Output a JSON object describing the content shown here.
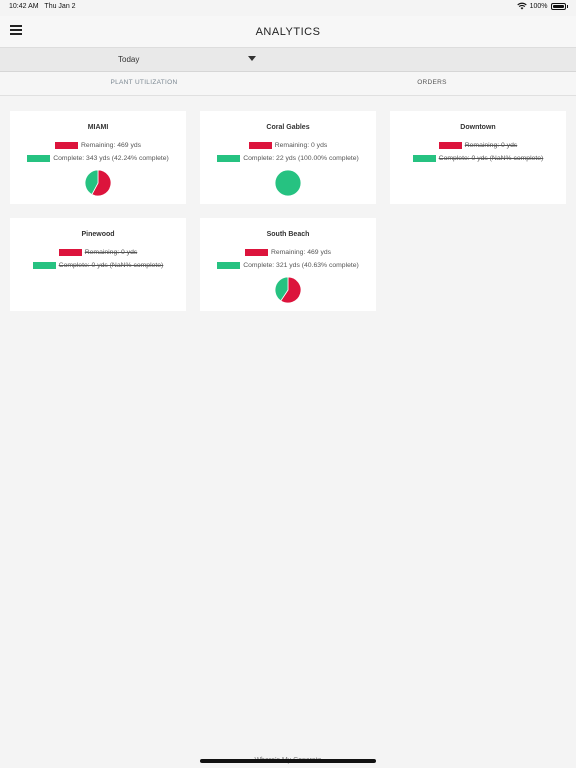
{
  "status_bar": {
    "time": "10:42 AM",
    "date": "Thu Jan 2",
    "battery": "100%"
  },
  "header": {
    "title": "ANALYTICS"
  },
  "period_select": {
    "value": "Today"
  },
  "tabs": [
    {
      "label": "PLANT UTILIZATION",
      "active": false
    },
    {
      "label": "ORDERS",
      "active": true
    }
  ],
  "colors": {
    "remaining": "#dc143c",
    "complete": "#26c281"
  },
  "cards": [
    {
      "title": "MIAMI",
      "remaining_label": "Remaining: 469 yds",
      "complete_label": "Complete: 343 yds (42.24% complete)",
      "remaining": 469,
      "complete": 343,
      "strikethrough": false
    },
    {
      "title": "Coral Gables",
      "remaining_label": "Remaining: 0 yds",
      "complete_label": "Complete: 22 yds (100.00% complete)",
      "remaining": 0,
      "complete": 22,
      "strikethrough": false
    },
    {
      "title": "Downtown",
      "remaining_label": "Remaining: 0 yds",
      "complete_label": "Complete: 0 yds (NaN% complete)",
      "remaining": 0,
      "complete": 0,
      "strikethrough": true
    },
    {
      "title": "Pinewood",
      "remaining_label": "Remaining: 0 yds",
      "complete_label": "Complete: 0 yds (NaN% complete)",
      "remaining": 0,
      "complete": 0,
      "strikethrough": true
    },
    {
      "title": "South Beach",
      "remaining_label": "Remaining: 469 yds",
      "complete_label": "Complete: 321 yds (40.63% complete)",
      "remaining": 469,
      "complete": 321,
      "strikethrough": false
    }
  ],
  "footer": {
    "text": "Where's My Concrete"
  }
}
